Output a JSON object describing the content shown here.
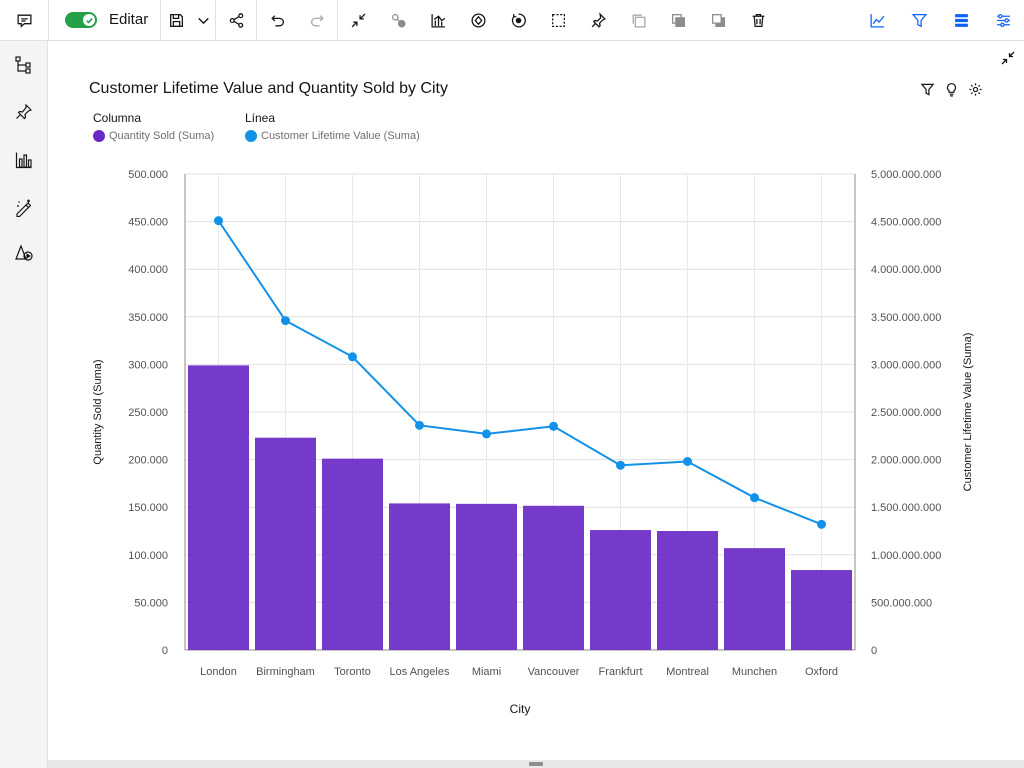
{
  "toolbar": {
    "edit_label": "Editar",
    "icons": [
      "comment-icon",
      "save-icon",
      "chevron-down-icon",
      "share-icon",
      "undo-icon",
      "redo-icon",
      "collapse-icon",
      "related-icon",
      "chart-type-icon",
      "navigate-icon",
      "snapshot-icon",
      "select-icon",
      "pin-icon",
      "copy-icon",
      "bring-forward-icon",
      "send-back-icon",
      "delete-icon",
      "insights-icon",
      "filter-icon",
      "panel-icon",
      "properties-icon"
    ]
  },
  "rail": {
    "icons": [
      "data-tree-icon",
      "pin-icon",
      "visualizations-icon",
      "assistant-icon",
      "shapes-icon"
    ]
  },
  "chart_data": {
    "type": "bar",
    "title": "Customer Lifetime Value and Quantity Sold by City",
    "xlabel": "City",
    "ylabel": "Quantity Sold (Suma)",
    "y2label": "Customer Lifetime Value (Suma)",
    "legend_column_header": "Columna",
    "legend_line_header": "Línea",
    "categories": [
      "London",
      "Birmingham",
      "Toronto",
      "Los Angeles",
      "Miami",
      "Vancouver",
      "Frankfurt",
      "Montreal",
      "Munchen",
      "Oxford"
    ],
    "series": [
      {
        "name": "Quantity Sold (Suma)",
        "type": "bar",
        "axis": "left",
        "color": "#6929c4",
        "values": [
          299000,
          223000,
          201000,
          154000,
          153500,
          151500,
          126000,
          125000,
          107000,
          84000
        ]
      },
      {
        "name": "Customer Lifetime Value (Suma)",
        "type": "line",
        "axis": "right",
        "color": "#1192e8",
        "values": [
          4510000000,
          3460000000,
          3080000000,
          2360000000,
          2270000000,
          2350000000,
          1940000000,
          1980000000,
          1600000000,
          1320000000
        ]
      }
    ],
    "ylim": [
      0,
      500000
    ],
    "y2lim": [
      0,
      5000000000
    ],
    "yticks": [
      "0",
      "50.000",
      "100.000",
      "150.000",
      "200.000",
      "250.000",
      "300.000",
      "350.000",
      "400.000",
      "450.000",
      "500.000"
    ],
    "y2ticks": [
      "0",
      "500.000.000",
      "1.000.000.000",
      "1.500.000.000",
      "2.000.000.000",
      "2.500.000.000",
      "3.000.000.000",
      "3.500.000.000",
      "4.000.000.000",
      "4.500.000.000",
      "5.000.000.000"
    ],
    "grid": true,
    "legend_position": "top-left"
  }
}
